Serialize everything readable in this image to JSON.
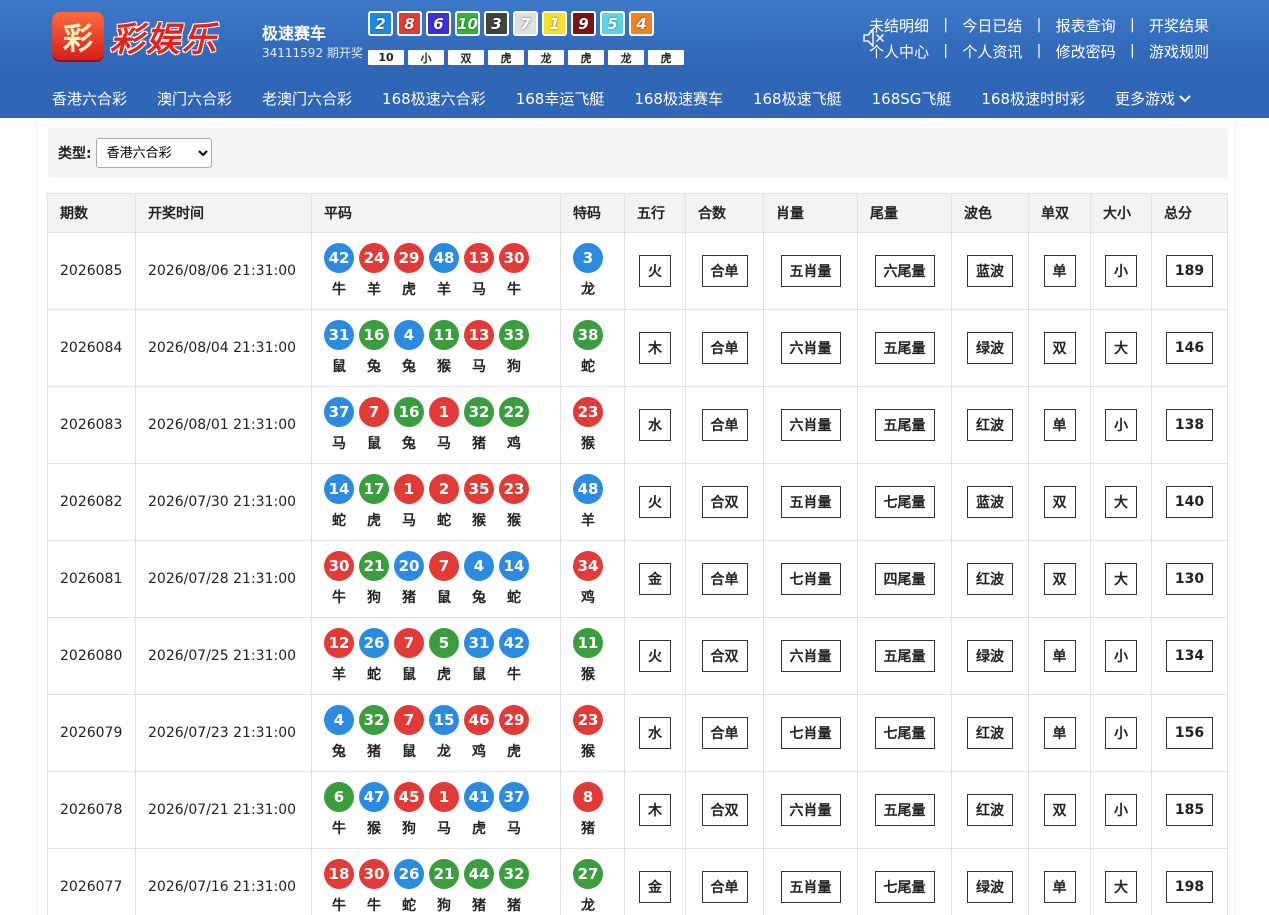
{
  "header": {
    "logo_badge": "彩",
    "logo_text": "彩娱乐",
    "game_title": "极速赛车",
    "issue_text": "34111592 期开奖",
    "pk_balls": [
      {
        "n": "2",
        "color": "#1e88e5"
      },
      {
        "n": "8",
        "color": "#e53935"
      },
      {
        "n": "6",
        "color": "#3f2fd6"
      },
      {
        "n": "10",
        "color": "#2eb82e"
      },
      {
        "n": "3",
        "color": "#424242"
      },
      {
        "n": "7",
        "color": "#e0e0e0"
      },
      {
        "n": "1",
        "color": "#f4e12b"
      },
      {
        "n": "9",
        "color": "#7b1416"
      },
      {
        "n": "5",
        "color": "#5fd3e8"
      },
      {
        "n": "4",
        "color": "#f5821f"
      }
    ],
    "pk_results": [
      "10",
      "小",
      "双",
      "虎",
      "龙",
      "虎",
      "龙",
      "虎"
    ],
    "links_row1": [
      "未结明细",
      "今日已结",
      "报表查询",
      "开奖结果"
    ],
    "links_row2": [
      "个人中心",
      "个人资讯",
      "修改密码",
      "游戏规则"
    ],
    "separator": "|"
  },
  "nav": {
    "items": [
      "香港六合彩",
      "澳门六合彩",
      "老澳门六合彩",
      "168极速六合彩",
      "168幸运飞艇",
      "168极速赛车",
      "168极速飞艇",
      "168SG飞艇",
      "168极速时时彩"
    ],
    "more": "更多游戏"
  },
  "filter": {
    "label": "类型:",
    "selected": "香港六合彩"
  },
  "table": {
    "headers": [
      "期数",
      "开奖时间",
      "平码",
      "特码",
      "五行",
      "合数",
      "肖量",
      "尾量",
      "波色",
      "单双",
      "大小",
      "总分"
    ],
    "rows": [
      {
        "issue": "2026085",
        "time": "2026/08/06 21:31:00",
        "balls": [
          {
            "n": "42",
            "c": "blue",
            "z": "牛"
          },
          {
            "n": "24",
            "c": "red",
            "z": "羊"
          },
          {
            "n": "29",
            "c": "red",
            "z": "虎"
          },
          {
            "n": "48",
            "c": "blue",
            "z": "羊"
          },
          {
            "n": "13",
            "c": "red",
            "z": "马"
          },
          {
            "n": "30",
            "c": "red",
            "z": "牛"
          }
        ],
        "special": {
          "n": "3",
          "c": "blue",
          "z": "龙"
        },
        "wuxing": "火",
        "heshu": "合单",
        "xiao": "五肖量",
        "wei": "六尾量",
        "bose": "蓝波",
        "danshuang": "单",
        "daxiao": "小",
        "total": "189"
      },
      {
        "issue": "2026084",
        "time": "2026/08/04 21:31:00",
        "balls": [
          {
            "n": "31",
            "c": "blue",
            "z": "鼠"
          },
          {
            "n": "16",
            "c": "green",
            "z": "兔"
          },
          {
            "n": "4",
            "c": "blue",
            "z": "兔"
          },
          {
            "n": "11",
            "c": "green",
            "z": "猴"
          },
          {
            "n": "13",
            "c": "red",
            "z": "马"
          },
          {
            "n": "33",
            "c": "green",
            "z": "狗"
          }
        ],
        "special": {
          "n": "38",
          "c": "green",
          "z": "蛇"
        },
        "wuxing": "木",
        "heshu": "合单",
        "xiao": "六肖量",
        "wei": "五尾量",
        "bose": "绿波",
        "danshuang": "双",
        "daxiao": "大",
        "total": "146"
      },
      {
        "issue": "2026083",
        "time": "2026/08/01 21:31:00",
        "balls": [
          {
            "n": "37",
            "c": "blue",
            "z": "马"
          },
          {
            "n": "7",
            "c": "red",
            "z": "鼠"
          },
          {
            "n": "16",
            "c": "green",
            "z": "兔"
          },
          {
            "n": "1",
            "c": "red",
            "z": "马"
          },
          {
            "n": "32",
            "c": "green",
            "z": "猪"
          },
          {
            "n": "22",
            "c": "green",
            "z": "鸡"
          }
        ],
        "special": {
          "n": "23",
          "c": "red",
          "z": "猴"
        },
        "wuxing": "水",
        "heshu": "合单",
        "xiao": "六肖量",
        "wei": "五尾量",
        "bose": "红波",
        "danshuang": "单",
        "daxiao": "小",
        "total": "138"
      },
      {
        "issue": "2026082",
        "time": "2026/07/30 21:31:00",
        "balls": [
          {
            "n": "14",
            "c": "blue",
            "z": "蛇"
          },
          {
            "n": "17",
            "c": "green",
            "z": "虎"
          },
          {
            "n": "1",
            "c": "red",
            "z": "马"
          },
          {
            "n": "2",
            "c": "red",
            "z": "蛇"
          },
          {
            "n": "35",
            "c": "red",
            "z": "猴"
          },
          {
            "n": "23",
            "c": "red",
            "z": "猴"
          }
        ],
        "special": {
          "n": "48",
          "c": "blue",
          "z": "羊"
        },
        "wuxing": "火",
        "heshu": "合双",
        "xiao": "五肖量",
        "wei": "七尾量",
        "bose": "蓝波",
        "danshuang": "双",
        "daxiao": "大",
        "total": "140"
      },
      {
        "issue": "2026081",
        "time": "2026/07/28 21:31:00",
        "balls": [
          {
            "n": "30",
            "c": "red",
            "z": "牛"
          },
          {
            "n": "21",
            "c": "green",
            "z": "狗"
          },
          {
            "n": "20",
            "c": "blue",
            "z": "猪"
          },
          {
            "n": "7",
            "c": "red",
            "z": "鼠"
          },
          {
            "n": "4",
            "c": "blue",
            "z": "兔"
          },
          {
            "n": "14",
            "c": "blue",
            "z": "蛇"
          }
        ],
        "special": {
          "n": "34",
          "c": "red",
          "z": "鸡"
        },
        "wuxing": "金",
        "heshu": "合单",
        "xiao": "七肖量",
        "wei": "四尾量",
        "bose": "红波",
        "danshuang": "双",
        "daxiao": "大",
        "total": "130"
      },
      {
        "issue": "2026080",
        "time": "2026/07/25 21:31:00",
        "balls": [
          {
            "n": "12",
            "c": "red",
            "z": "羊"
          },
          {
            "n": "26",
            "c": "blue",
            "z": "蛇"
          },
          {
            "n": "7",
            "c": "red",
            "z": "鼠"
          },
          {
            "n": "5",
            "c": "green",
            "z": "虎"
          },
          {
            "n": "31",
            "c": "blue",
            "z": "鼠"
          },
          {
            "n": "42",
            "c": "blue",
            "z": "牛"
          }
        ],
        "special": {
          "n": "11",
          "c": "green",
          "z": "猴"
        },
        "wuxing": "火",
        "heshu": "合双",
        "xiao": "六肖量",
        "wei": "五尾量",
        "bose": "绿波",
        "danshuang": "单",
        "daxiao": "小",
        "total": "134"
      },
      {
        "issue": "2026079",
        "time": "2026/07/23 21:31:00",
        "balls": [
          {
            "n": "4",
            "c": "blue",
            "z": "兔"
          },
          {
            "n": "32",
            "c": "green",
            "z": "猪"
          },
          {
            "n": "7",
            "c": "red",
            "z": "鼠"
          },
          {
            "n": "15",
            "c": "blue",
            "z": "龙"
          },
          {
            "n": "46",
            "c": "red",
            "z": "鸡"
          },
          {
            "n": "29",
            "c": "red",
            "z": "虎"
          }
        ],
        "special": {
          "n": "23",
          "c": "red",
          "z": "猴"
        },
        "wuxing": "水",
        "heshu": "合单",
        "xiao": "七肖量",
        "wei": "七尾量",
        "bose": "红波",
        "danshuang": "单",
        "daxiao": "小",
        "total": "156"
      },
      {
        "issue": "2026078",
        "time": "2026/07/21 21:31:00",
        "balls": [
          {
            "n": "6",
            "c": "green",
            "z": "牛"
          },
          {
            "n": "47",
            "c": "blue",
            "z": "猴"
          },
          {
            "n": "45",
            "c": "red",
            "z": "狗"
          },
          {
            "n": "1",
            "c": "red",
            "z": "马"
          },
          {
            "n": "41",
            "c": "blue",
            "z": "虎"
          },
          {
            "n": "37",
            "c": "blue",
            "z": "马"
          }
        ],
        "special": {
          "n": "8",
          "c": "red",
          "z": "猪"
        },
        "wuxing": "木",
        "heshu": "合双",
        "xiao": "六肖量",
        "wei": "五尾量",
        "bose": "红波",
        "danshuang": "双",
        "daxiao": "小",
        "total": "185"
      },
      {
        "issue": "2026077",
        "time": "2026/07/16 21:31:00",
        "balls": [
          {
            "n": "18",
            "c": "red",
            "z": "牛"
          },
          {
            "n": "30",
            "c": "red",
            "z": "牛"
          },
          {
            "n": "26",
            "c": "blue",
            "z": "蛇"
          },
          {
            "n": "21",
            "c": "green",
            "z": "狗"
          },
          {
            "n": "44",
            "c": "green",
            "z": "猪"
          },
          {
            "n": "32",
            "c": "green",
            "z": "猪"
          }
        ],
        "special": {
          "n": "27",
          "c": "green",
          "z": "龙"
        },
        "wuxing": "金",
        "heshu": "合单",
        "xiao": "五肖量",
        "wei": "七尾量",
        "bose": "绿波",
        "danshuang": "单",
        "daxiao": "大",
        "total": "198"
      }
    ]
  }
}
